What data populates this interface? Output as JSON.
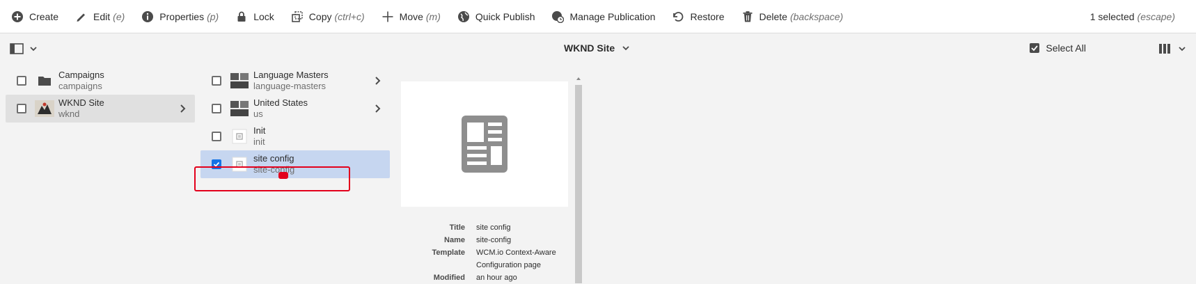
{
  "toolbar": {
    "items": [
      {
        "label": "Create",
        "shortcut": ""
      },
      {
        "label": "Edit",
        "shortcut": "(e)"
      },
      {
        "label": "Properties",
        "shortcut": "(p)"
      },
      {
        "label": "Lock",
        "shortcut": ""
      },
      {
        "label": "Copy",
        "shortcut": "(ctrl+c)"
      },
      {
        "label": "Move",
        "shortcut": "(m)"
      },
      {
        "label": "Quick Publish",
        "shortcut": ""
      },
      {
        "label": "Manage Publication",
        "shortcut": ""
      },
      {
        "label": "Restore",
        "shortcut": ""
      },
      {
        "label": "Delete",
        "shortcut": "(backspace)"
      }
    ],
    "selection_count": "1 selected",
    "escape_hint": "(escape)"
  },
  "header": {
    "site_title": "WKND Site",
    "select_all": "Select All"
  },
  "columns": {
    "col1": [
      {
        "title": "Campaigns",
        "name": "campaigns"
      },
      {
        "title": "WKND Site",
        "name": "wknd"
      }
    ],
    "col2": [
      {
        "title": "Language Masters",
        "name": "language-masters"
      },
      {
        "title": "United States",
        "name": "us"
      },
      {
        "title": "Init",
        "name": "init"
      },
      {
        "title": "site config",
        "name": "site-config"
      }
    ]
  },
  "details": {
    "title_label": "Title",
    "title_value": "site config",
    "name_label": "Name",
    "name_value": "site-config",
    "template_label": "Template",
    "template_value_1": "WCM.io Context-Aware",
    "template_value_2": "Configuration page",
    "modified_label": "Modified",
    "modified_value": "an hour ago"
  },
  "colors": {
    "accent": "#1473e6",
    "selection": "#c6d6f0",
    "highlight_box": "#e3001b"
  }
}
